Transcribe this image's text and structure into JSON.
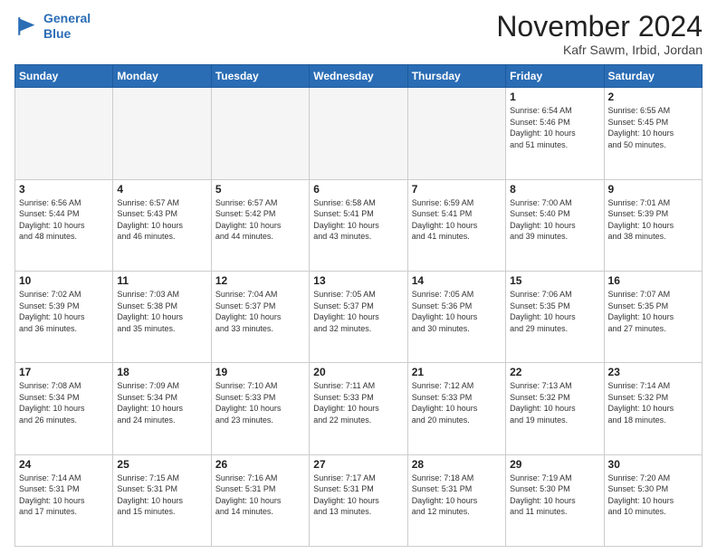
{
  "header": {
    "logo_line1": "General",
    "logo_line2": "Blue",
    "month": "November 2024",
    "location": "Kafr Sawm, Irbid, Jordan"
  },
  "weekdays": [
    "Sunday",
    "Monday",
    "Tuesday",
    "Wednesday",
    "Thursday",
    "Friday",
    "Saturday"
  ],
  "weeks": [
    [
      {
        "day": "",
        "info": ""
      },
      {
        "day": "",
        "info": ""
      },
      {
        "day": "",
        "info": ""
      },
      {
        "day": "",
        "info": ""
      },
      {
        "day": "",
        "info": ""
      },
      {
        "day": "1",
        "info": "Sunrise: 6:54 AM\nSunset: 5:46 PM\nDaylight: 10 hours\nand 51 minutes."
      },
      {
        "day": "2",
        "info": "Sunrise: 6:55 AM\nSunset: 5:45 PM\nDaylight: 10 hours\nand 50 minutes."
      }
    ],
    [
      {
        "day": "3",
        "info": "Sunrise: 6:56 AM\nSunset: 5:44 PM\nDaylight: 10 hours\nand 48 minutes."
      },
      {
        "day": "4",
        "info": "Sunrise: 6:57 AM\nSunset: 5:43 PM\nDaylight: 10 hours\nand 46 minutes."
      },
      {
        "day": "5",
        "info": "Sunrise: 6:57 AM\nSunset: 5:42 PM\nDaylight: 10 hours\nand 44 minutes."
      },
      {
        "day": "6",
        "info": "Sunrise: 6:58 AM\nSunset: 5:41 PM\nDaylight: 10 hours\nand 43 minutes."
      },
      {
        "day": "7",
        "info": "Sunrise: 6:59 AM\nSunset: 5:41 PM\nDaylight: 10 hours\nand 41 minutes."
      },
      {
        "day": "8",
        "info": "Sunrise: 7:00 AM\nSunset: 5:40 PM\nDaylight: 10 hours\nand 39 minutes."
      },
      {
        "day": "9",
        "info": "Sunrise: 7:01 AM\nSunset: 5:39 PM\nDaylight: 10 hours\nand 38 minutes."
      }
    ],
    [
      {
        "day": "10",
        "info": "Sunrise: 7:02 AM\nSunset: 5:39 PM\nDaylight: 10 hours\nand 36 minutes."
      },
      {
        "day": "11",
        "info": "Sunrise: 7:03 AM\nSunset: 5:38 PM\nDaylight: 10 hours\nand 35 minutes."
      },
      {
        "day": "12",
        "info": "Sunrise: 7:04 AM\nSunset: 5:37 PM\nDaylight: 10 hours\nand 33 minutes."
      },
      {
        "day": "13",
        "info": "Sunrise: 7:05 AM\nSunset: 5:37 PM\nDaylight: 10 hours\nand 32 minutes."
      },
      {
        "day": "14",
        "info": "Sunrise: 7:05 AM\nSunset: 5:36 PM\nDaylight: 10 hours\nand 30 minutes."
      },
      {
        "day": "15",
        "info": "Sunrise: 7:06 AM\nSunset: 5:35 PM\nDaylight: 10 hours\nand 29 minutes."
      },
      {
        "day": "16",
        "info": "Sunrise: 7:07 AM\nSunset: 5:35 PM\nDaylight: 10 hours\nand 27 minutes."
      }
    ],
    [
      {
        "day": "17",
        "info": "Sunrise: 7:08 AM\nSunset: 5:34 PM\nDaylight: 10 hours\nand 26 minutes."
      },
      {
        "day": "18",
        "info": "Sunrise: 7:09 AM\nSunset: 5:34 PM\nDaylight: 10 hours\nand 24 minutes."
      },
      {
        "day": "19",
        "info": "Sunrise: 7:10 AM\nSunset: 5:33 PM\nDaylight: 10 hours\nand 23 minutes."
      },
      {
        "day": "20",
        "info": "Sunrise: 7:11 AM\nSunset: 5:33 PM\nDaylight: 10 hours\nand 22 minutes."
      },
      {
        "day": "21",
        "info": "Sunrise: 7:12 AM\nSunset: 5:33 PM\nDaylight: 10 hours\nand 20 minutes."
      },
      {
        "day": "22",
        "info": "Sunrise: 7:13 AM\nSunset: 5:32 PM\nDaylight: 10 hours\nand 19 minutes."
      },
      {
        "day": "23",
        "info": "Sunrise: 7:14 AM\nSunset: 5:32 PM\nDaylight: 10 hours\nand 18 minutes."
      }
    ],
    [
      {
        "day": "24",
        "info": "Sunrise: 7:14 AM\nSunset: 5:31 PM\nDaylight: 10 hours\nand 17 minutes."
      },
      {
        "day": "25",
        "info": "Sunrise: 7:15 AM\nSunset: 5:31 PM\nDaylight: 10 hours\nand 15 minutes."
      },
      {
        "day": "26",
        "info": "Sunrise: 7:16 AM\nSunset: 5:31 PM\nDaylight: 10 hours\nand 14 minutes."
      },
      {
        "day": "27",
        "info": "Sunrise: 7:17 AM\nSunset: 5:31 PM\nDaylight: 10 hours\nand 13 minutes."
      },
      {
        "day": "28",
        "info": "Sunrise: 7:18 AM\nSunset: 5:31 PM\nDaylight: 10 hours\nand 12 minutes."
      },
      {
        "day": "29",
        "info": "Sunrise: 7:19 AM\nSunset: 5:30 PM\nDaylight: 10 hours\nand 11 minutes."
      },
      {
        "day": "30",
        "info": "Sunrise: 7:20 AM\nSunset: 5:30 PM\nDaylight: 10 hours\nand 10 minutes."
      }
    ]
  ]
}
